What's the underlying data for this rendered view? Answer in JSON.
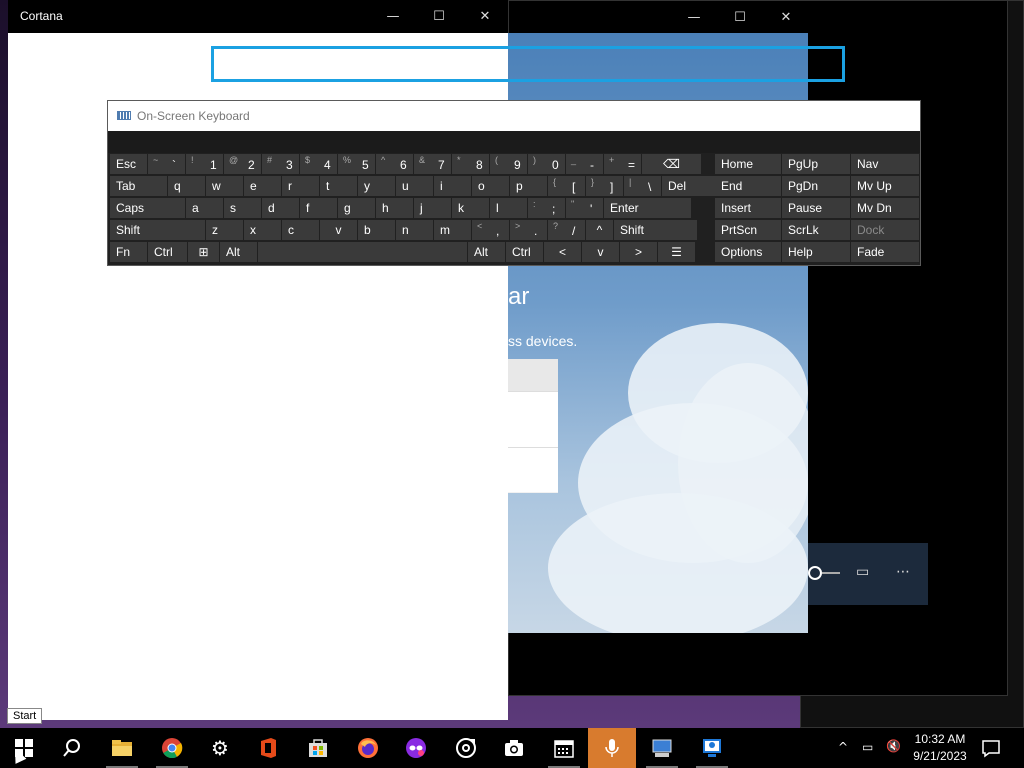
{
  "cortana_window": {
    "title": "Cortana",
    "controls": {
      "minimize": "—",
      "maximize": "☐",
      "close": "✕"
    }
  },
  "background_window": {
    "heading_fragment": "ar",
    "subtext_fragment": "ss devices."
  },
  "osk": {
    "title": "On-Screen Keyboard",
    "rows": [
      [
        {
          "id": "esc",
          "label": "Esc"
        },
        {
          "id": "backtick",
          "shift": "~",
          "main": "`"
        },
        {
          "id": "1",
          "shift": "!",
          "main": "1"
        },
        {
          "id": "2",
          "shift": "@",
          "main": "2"
        },
        {
          "id": "3",
          "shift": "#",
          "main": "3"
        },
        {
          "id": "4",
          "shift": "$",
          "main": "4"
        },
        {
          "id": "5",
          "shift": "%",
          "main": "5"
        },
        {
          "id": "6",
          "shift": "^",
          "main": "6"
        },
        {
          "id": "7",
          "shift": "&",
          "main": "7"
        },
        {
          "id": "8",
          "shift": "*",
          "main": "8"
        },
        {
          "id": "9",
          "shift": "(",
          "main": "9"
        },
        {
          "id": "0",
          "shift": ")",
          "main": "0"
        },
        {
          "id": "minus",
          "shift": "_",
          "main": "-"
        },
        {
          "id": "equals",
          "shift": "+",
          "main": "="
        },
        {
          "id": "backspace",
          "label": "⌫"
        }
      ],
      [
        {
          "id": "tab",
          "label": "Tab"
        },
        {
          "id": "q",
          "label": "q"
        },
        {
          "id": "w",
          "label": "w"
        },
        {
          "id": "e",
          "label": "e"
        },
        {
          "id": "r",
          "label": "r"
        },
        {
          "id": "t",
          "label": "t"
        },
        {
          "id": "y",
          "label": "y"
        },
        {
          "id": "u",
          "label": "u"
        },
        {
          "id": "i",
          "label": "i"
        },
        {
          "id": "o",
          "label": "o"
        },
        {
          "id": "p",
          "label": "p"
        },
        {
          "id": "lbracket",
          "shift": "{",
          "main": "["
        },
        {
          "id": "rbracket",
          "shift": "}",
          "main": "]"
        },
        {
          "id": "backslash",
          "shift": "|",
          "main": "\\"
        },
        {
          "id": "del",
          "label": "Del"
        }
      ],
      [
        {
          "id": "caps",
          "label": "Caps"
        },
        {
          "id": "a",
          "label": "a"
        },
        {
          "id": "s",
          "label": "s"
        },
        {
          "id": "d",
          "label": "d"
        },
        {
          "id": "f",
          "label": "f"
        },
        {
          "id": "g",
          "label": "g"
        },
        {
          "id": "h",
          "label": "h"
        },
        {
          "id": "j",
          "label": "j"
        },
        {
          "id": "k",
          "label": "k"
        },
        {
          "id": "l",
          "label": "l"
        },
        {
          "id": "semicolon",
          "shift": ":",
          "main": ";"
        },
        {
          "id": "quote",
          "shift": "\"",
          "main": "'"
        },
        {
          "id": "enter",
          "label": "Enter"
        }
      ],
      [
        {
          "id": "shift_l",
          "label": "Shift"
        },
        {
          "id": "z",
          "label": "z"
        },
        {
          "id": "x",
          "label": "x"
        },
        {
          "id": "c",
          "label": "c"
        },
        {
          "id": "v",
          "label": "v"
        },
        {
          "id": "b",
          "label": "b"
        },
        {
          "id": "n",
          "label": "n"
        },
        {
          "id": "m",
          "label": "m"
        },
        {
          "id": "comma",
          "shift": "<",
          "main": ","
        },
        {
          "id": "period",
          "shift": ">",
          "main": "."
        },
        {
          "id": "slash",
          "shift": "?",
          "main": "/"
        },
        {
          "id": "up",
          "label": "^"
        },
        {
          "id": "shift_r",
          "label": "Shift"
        }
      ],
      [
        {
          "id": "fn",
          "label": "Fn"
        },
        {
          "id": "ctrl_l",
          "label": "Ctrl"
        },
        {
          "id": "win",
          "label": "⊞"
        },
        {
          "id": "alt_l",
          "label": "Alt"
        },
        {
          "id": "space",
          "label": ""
        },
        {
          "id": "alt_r",
          "label": "Alt"
        },
        {
          "id": "ctrl_r",
          "label": "Ctrl"
        },
        {
          "id": "left",
          "label": "<"
        },
        {
          "id": "down",
          "label": "v"
        },
        {
          "id": "right",
          "label": ">"
        },
        {
          "id": "menu",
          "label": "☰"
        }
      ]
    ],
    "side_keys": [
      [
        "Home",
        "PgUp",
        "Nav"
      ],
      [
        "End",
        "PgDn",
        "Mv Up"
      ],
      [
        "Insert",
        "Pause",
        "Mv Dn"
      ],
      [
        "PrtScn",
        "ScrLk",
        "Dock"
      ],
      [
        "Options",
        "Help",
        "Fade"
      ]
    ]
  },
  "tooltip": "Start",
  "taskbar": {
    "apps": [
      "start",
      "search",
      "file-explorer",
      "chrome",
      "settings",
      "office",
      "store",
      "firefox",
      "app-mask",
      "app-disc",
      "camera",
      "calendar",
      "microphone",
      "app-computer",
      "app-remote"
    ],
    "tray": {
      "chevron": "^",
      "time": "10:32 AM",
      "date": "9/21/2023"
    }
  }
}
